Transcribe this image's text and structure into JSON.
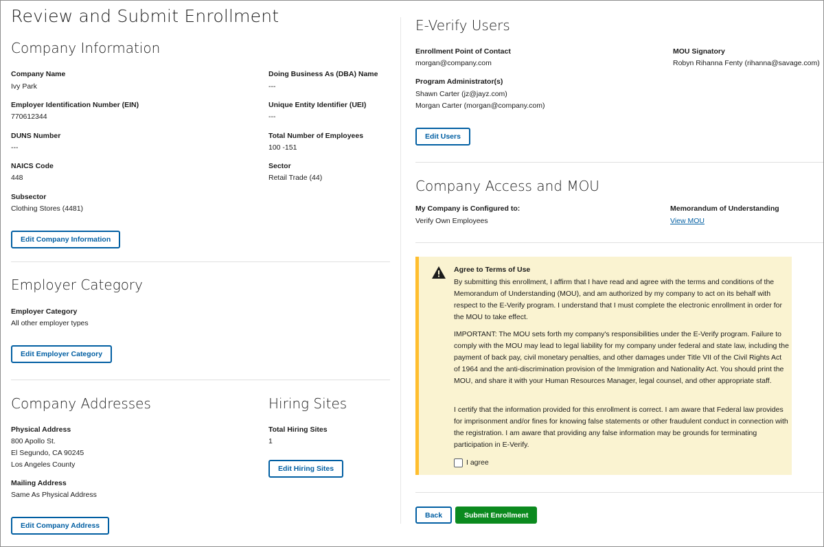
{
  "page_title": "Review and Submit Enrollment",
  "company_info": {
    "title": "Company Information",
    "fields": {
      "company_name": {
        "label": "Company Name",
        "value": "Ivy Park"
      },
      "dba_name": {
        "label": "Doing Business As (DBA) Name",
        "value": "---"
      },
      "ein": {
        "label": "Employer Identification Number (EIN)",
        "value": "770612344"
      },
      "uei": {
        "label": "Unique Entity Identifier (UEI)",
        "value": "---"
      },
      "duns": {
        "label": "DUNS Number",
        "value": "---"
      },
      "total_employees": {
        "label": "Total Number of Employees",
        "value": "100 -151"
      },
      "naics": {
        "label": "NAICS Code",
        "value": "448"
      },
      "sector": {
        "label": "Sector",
        "value": "Retail Trade (44)"
      },
      "subsector": {
        "label": "Subsector",
        "value": "Clothing Stores (4481)"
      }
    },
    "edit_button": "Edit Company Information"
  },
  "employer_category": {
    "title": "Employer Category",
    "label": "Employer Category",
    "value": "All other employer types",
    "edit_button": "Edit Employer Category"
  },
  "company_addresses": {
    "title": "Company Addresses",
    "physical_label": "Physical Address",
    "physical_lines": [
      "800 Apollo St.",
      "El Segundo, CA 90245",
      "Los Angeles County"
    ],
    "mailing_label": "Mailing Address",
    "mailing_value": "Same As Physical Address",
    "edit_button": "Edit Company Address"
  },
  "hiring_sites": {
    "title": "Hiring Sites",
    "label": "Total Hiring Sites",
    "value": "1",
    "edit_button": "Edit Hiring Sites"
  },
  "everify_users": {
    "title": "E-Verify Users",
    "poc_label": "Enrollment Point of Contact",
    "poc_value": "morgan@company.com",
    "signatory_label": "MOU Signatory",
    "signatory_value": "Robyn Rihanna Fenty (rihanna@savage.com)",
    "admins_label": "Program Administrator(s)",
    "admins": [
      "Shawn Carter (jz@jayz.com)",
      "Morgan Carter (morgan@company.com)"
    ],
    "edit_button": "Edit Users"
  },
  "access_mou": {
    "title": "Company Access and MOU",
    "configured_label": "My Company is Configured to:",
    "configured_value": "Verify Own Employees",
    "mou_label": "Memorandum of Understanding",
    "mou_link": "View MOU"
  },
  "terms": {
    "title": "Agree to Terms of Use",
    "paragraphs": [
      "By submitting this enrollment, I affirm that I have read and agree with the terms and conditions of the Memorandum of Understanding (MOU), and am authorized by my company to act on its behalf with respect to the E-Verify program. I understand that I must complete the electronic enrollment in order for the MOU to take effect.",
      "IMPORTANT: The MOU sets forth my company's responsibilities under the E-Verify program. Failure to comply with the MOU may lead to legal liability for my company under federal and state law, including the payment of back pay, civil monetary penalties, and other damages under Title VII of the Civil Rights Act of 1964 and the anti-discrimination provision of the Immigration and Nationality Act. You should print the MOU, and share it with your Human Resources Manager, legal counsel, and other appropriate staff.",
      "I certify that the information provided for this enrollment is correct. I am aware that Federal law provides for imprisonment and/or fines for knowing false statements or other fraudulent conduct in connection with the registration. I am aware that providing any false information may be grounds for terminating participation in E-Verify."
    ],
    "agree_label": "I agree",
    "icon": "warning-icon",
    "colors": {
      "background": "#faf3d1",
      "accent": "#ffbe2e"
    }
  },
  "actions": {
    "back": "Back",
    "submit": "Submit Enrollment"
  },
  "colors": {
    "primary": "#005ea2",
    "success": "#0b8a1e"
  }
}
